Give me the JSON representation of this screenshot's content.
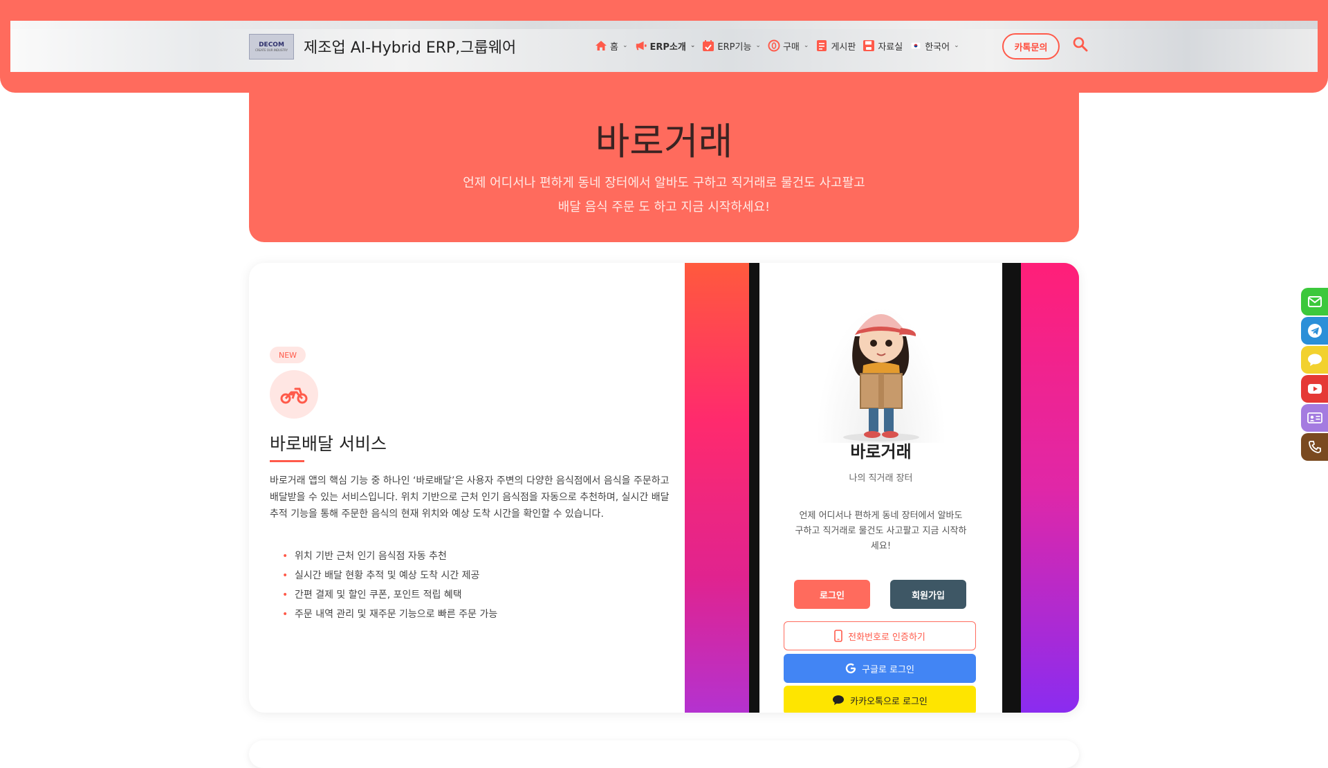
{
  "header": {
    "logo_text": "DECOM",
    "logo_sub": "CREATE OUR INDUSTRY",
    "site_title": "제조업 AI-Hybrid ERP,그룹웨어",
    "nav": [
      {
        "label": "홈",
        "icon": "home-icon"
      },
      {
        "label": "ERP소개",
        "icon": "megaphone-icon"
      },
      {
        "label": "ERP기능",
        "icon": "calendar-check-icon"
      },
      {
        "label": "구매",
        "icon": "coin-icon"
      },
      {
        "label": "게시판",
        "icon": "board-icon"
      },
      {
        "label": "자료실",
        "icon": "save-icon"
      },
      {
        "label": "한국어",
        "icon": "korea-flag-icon"
      }
    ],
    "kakao_button": "카톡문의",
    "accent_color": "#ff6b5d"
  },
  "hero": {
    "title": "바로거래",
    "line1": "언제 어디서나 편하게 동네 장터에서 알바도 구하고 직거래로 물건도 사고팔고",
    "line2": "배달 음식 주문 도 하고 지금 시작하세요!"
  },
  "feature": {
    "badge": "NEW",
    "icon": "motorcycle-icon",
    "title": "바로배달 서비스",
    "description": "바로거래 앱의 핵심 기능 중 하나인 ‘바로배달’은 사용자 주변의 다양한 음식점에서 음식을 주문하고 배달받을 수 있는 서비스입니다. 위치 기반으로 근처 인기 음식점을 자동으로 추천하며, 실시간 배달 추적 기능을 통해 주문한 음식의 현재 위치와 예상 도착 시간을 확인할 수 있습니다.",
    "bullets": [
      "위치 기반 근처 인기 음식점 자동 추천",
      "실시간 배달 현황 추적 및 예상 도착 시간 제공",
      "간편 결제 및 할인 쿠폰, 포인트 적립 혜택",
      "주문 내역 관리 및 재주문 기능으로 빠른 주문 가능"
    ]
  },
  "phone": {
    "app_name": "바로거래",
    "app_sub": "나의 직거래 장터",
    "app_desc": "언제 어디서나 편하게 동네 장터에서 알바도 구하고 직거래로 물건도 사고팔고 지금 시작하세요!",
    "login": "로그인",
    "join": "회원가입",
    "phone_auth": "전화번호로 인증하기",
    "google_login": "구글로 로그인",
    "kakao_login": "카카오톡으로 로그인"
  },
  "float_buttons": [
    {
      "icon": "mail-icon",
      "color": "#3cc83c"
    },
    {
      "icon": "telegram-icon",
      "color": "#2a8fd8"
    },
    {
      "icon": "chat-icon",
      "color": "#f2d12e"
    },
    {
      "icon": "youtube-icon",
      "color": "#e53935"
    },
    {
      "icon": "contact-card-icon",
      "color": "#a47be0"
    },
    {
      "icon": "phone-icon",
      "color": "#7a4a20"
    }
  ]
}
